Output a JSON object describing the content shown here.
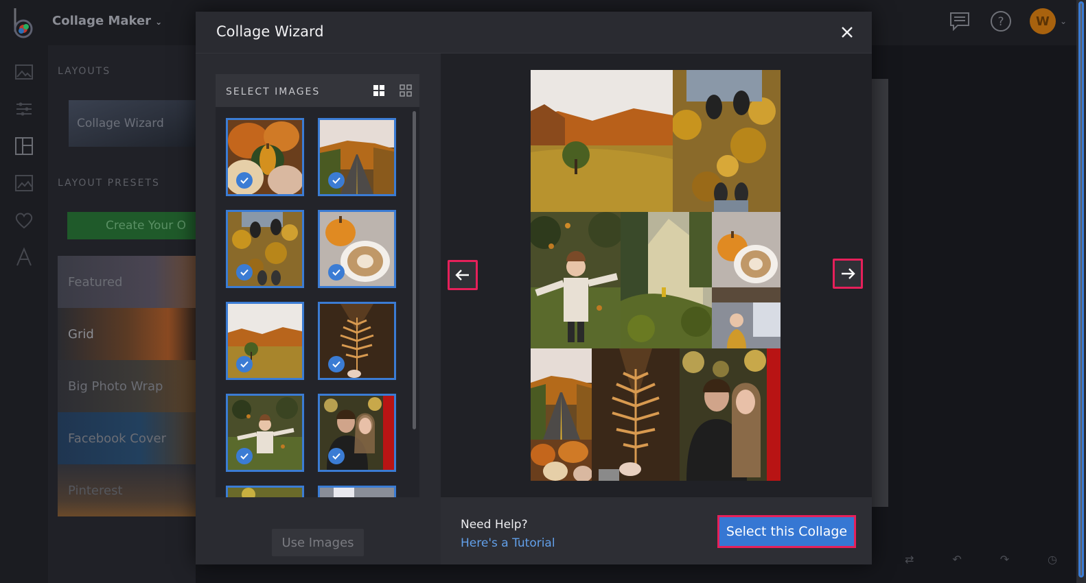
{
  "app": {
    "title": "Collage Maker",
    "avatar_letter": "W"
  },
  "sidepanel": {
    "layouts_heading": "LAYOUTS",
    "wizard_tile": "Collage Wizard",
    "presets_heading": "LAYOUT PRESETS",
    "create_button": "Create Your O",
    "presets": [
      "Featured",
      "Grid",
      "Big Photo Wrap",
      "Facebook Cover",
      "Pinterest"
    ]
  },
  "modal": {
    "title": "Collage Wizard",
    "select_images_heading": "SELECT IMAGES",
    "use_images_button": "Use Images",
    "thumbnails": [
      {
        "subject": "pumpkins",
        "selected": true
      },
      {
        "subject": "autumn road",
        "selected": true
      },
      {
        "subject": "feet in leaves",
        "selected": true
      },
      {
        "subject": "pumpkin and coffee",
        "selected": true
      },
      {
        "subject": "autumn field",
        "selected": true
      },
      {
        "subject": "fern leaf on path",
        "selected": true
      },
      {
        "subject": "girl in leaves",
        "selected": true
      },
      {
        "subject": "couple",
        "selected": true
      }
    ],
    "help_question": "Need Help?",
    "help_link": "Here's a Tutorial",
    "select_collage_button": "Select this Collage"
  },
  "colors": {
    "accent_blue": "#3677d3",
    "highlight_pink": "#e6205a",
    "link_blue": "#62a0ea"
  }
}
